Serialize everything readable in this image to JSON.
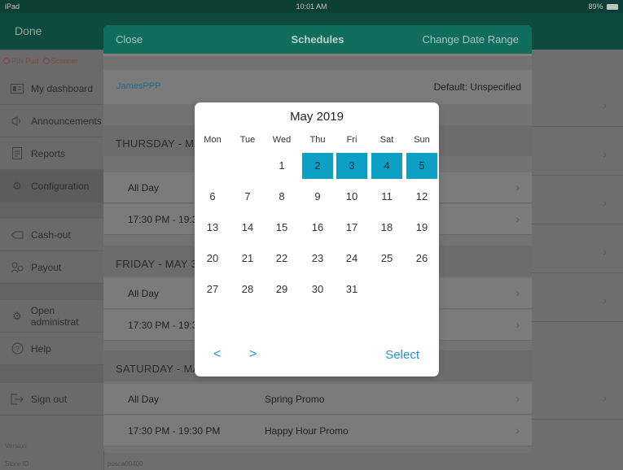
{
  "status_bar": {
    "left": "iPad",
    "time": "10:01 AM",
    "battery": "89%"
  },
  "app_bar": {
    "done_label": "Done"
  },
  "sidebar": {
    "pin_pad": "PIN Pad",
    "scanner": "Scanner",
    "items": [
      {
        "label": "My dashboard",
        "icon": "dashboard-icon"
      },
      {
        "label": "Announcements",
        "icon": "megaphone-icon"
      },
      {
        "label": "Reports",
        "icon": "document-icon"
      },
      {
        "label": "Configuration",
        "icon": "gear-icon"
      },
      {
        "label": "Cash-out",
        "icon": "cash-icon"
      },
      {
        "label": "Payout",
        "icon": "payout-icon"
      },
      {
        "label": "Open administrat",
        "icon": "admin-icon"
      },
      {
        "label": "Help",
        "icon": "help-icon"
      },
      {
        "label": "Sign out",
        "icon": "sign-out-icon"
      }
    ],
    "version_label": "Version",
    "store_id_label": "Store ID",
    "store_id_value": "posca00400"
  },
  "modal": {
    "close_label": "Close",
    "title": "Schedules",
    "change_range_label": "Change Date Range",
    "user": "JamesPPP",
    "default_text": "Default: Unspecified",
    "days": [
      {
        "header": "THURSDAY - MA",
        "rows": [
          {
            "time": "All Day",
            "promo": ""
          },
          {
            "time": "17:30 PM - 19:3",
            "promo": ""
          }
        ]
      },
      {
        "header": "FRIDAY - MAY 3",
        "rows": [
          {
            "time": "All Day",
            "promo": ""
          },
          {
            "time": "17:30 PM - 19:3",
            "promo": ""
          }
        ]
      },
      {
        "header": "SATURDAY - MA",
        "rows": [
          {
            "time": "All Day",
            "promo": "Spring Promo"
          },
          {
            "time": "17:30 PM - 19:30 PM",
            "promo": "Happy Hour Promo"
          }
        ]
      }
    ]
  },
  "calendar": {
    "month_title": "May 2019",
    "weekdays": [
      "Mon",
      "Tue",
      "Wed",
      "Thu",
      "Fri",
      "Sat",
      "Sun"
    ],
    "first_weekday_index": 2,
    "days_in_month": 31,
    "selected_days": [
      2,
      3,
      4,
      5
    ],
    "prev_label": "<",
    "next_label": ">",
    "select_label": "Select",
    "accent_color": "#0e9fc4"
  }
}
